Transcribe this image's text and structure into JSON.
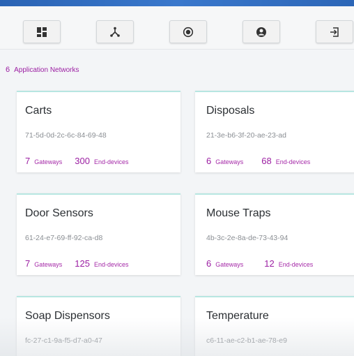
{
  "toolbar": {
    "buttons": [
      {
        "icon": "dashboard-grid-icon"
      },
      {
        "icon": "network-topology-icon"
      },
      {
        "icon": "radio-record-icon"
      },
      {
        "icon": "user-circle-icon"
      },
      {
        "icon": "sign-in-icon"
      }
    ]
  },
  "summary": {
    "count": "6",
    "label": "Application Networks"
  },
  "networks": [
    {
      "name": "Carts",
      "mac": "71-5d-0d-2c-6c-84-69-48",
      "gateways": "7",
      "gateways_label": "Gateways",
      "devices": "300",
      "devices_label": "End-devices"
    },
    {
      "name": "Disposals",
      "mac": "21-3e-b6-3f-20-ae-23-ad",
      "gateways": "6",
      "gateways_label": "Gateways",
      "devices": "68",
      "devices_label": "End-devices"
    },
    {
      "name": "Door Sensors",
      "mac": "61-24-e7-69-ff-92-ca-d8",
      "gateways": "7",
      "gateways_label": "Gateways",
      "devices": "125",
      "devices_label": "End-devices"
    },
    {
      "name": "Mouse Traps",
      "mac": "4b-3c-2e-8a-de-73-43-94",
      "gateways": "6",
      "gateways_label": "Gateways",
      "devices": "12",
      "devices_label": "End-devices"
    },
    {
      "name": "Soap Dispensors",
      "mac": "fc-27-c1-9a-f5-d7-a0-47"
    },
    {
      "name": "Temperature",
      "mac": "c6-11-ae-c2-b1-ae-78-e9"
    }
  ],
  "colors": {
    "accent_purple": "#9b1ea2",
    "card_top_border": "#b7e6e1",
    "top_bar_blue": "#2a63b4"
  }
}
